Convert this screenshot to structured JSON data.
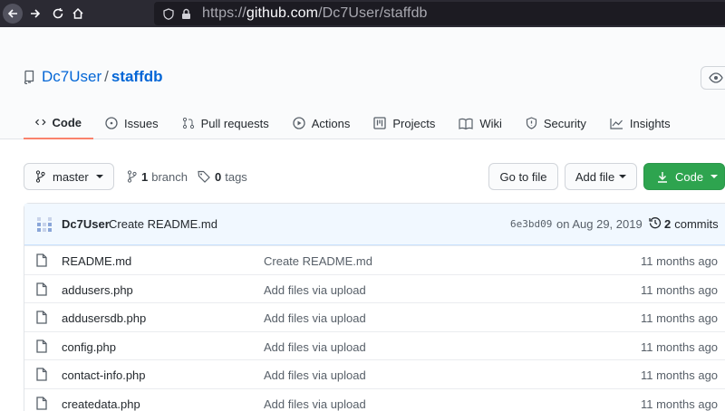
{
  "browser": {
    "url_prefix": "https://",
    "url_domain": "github.com",
    "url_path": "/Dc7User/staffdb"
  },
  "repo": {
    "owner": "Dc7User",
    "separator": "/",
    "name": "staffdb"
  },
  "tabs": [
    {
      "label": "Code",
      "icon": "code-icon"
    },
    {
      "label": "Issues",
      "icon": "issue-icon"
    },
    {
      "label": "Pull requests",
      "icon": "pull-request-icon"
    },
    {
      "label": "Actions",
      "icon": "play-icon"
    },
    {
      "label": "Projects",
      "icon": "project-icon"
    },
    {
      "label": "Wiki",
      "icon": "book-icon"
    },
    {
      "label": "Security",
      "icon": "shield-icon"
    },
    {
      "label": "Insights",
      "icon": "graph-icon"
    }
  ],
  "toolbar": {
    "branch": "master",
    "branches_count": "1",
    "branches_label": "branch",
    "tags_count": "0",
    "tags_label": "tags",
    "goto_file": "Go to file",
    "add_file": "Add file",
    "code": "Code"
  },
  "latest_commit": {
    "author": "Dc7User",
    "message": "Create README.md",
    "sha": "6e3bd09",
    "date": "on Aug 29, 2019",
    "commits_count": "2",
    "commits_label": "commits"
  },
  "files": [
    {
      "name": "README.md",
      "commit": "Create README.md",
      "age": "11 months ago"
    },
    {
      "name": "addusers.php",
      "commit": "Add files via upload",
      "age": "11 months ago"
    },
    {
      "name": "addusersdb.php",
      "commit": "Add files via upload",
      "age": "11 months ago"
    },
    {
      "name": "config.php",
      "commit": "Add files via upload",
      "age": "11 months ago"
    },
    {
      "name": "contact-info.php",
      "commit": "Add files via upload",
      "age": "11 months ago"
    },
    {
      "name": "createdata.php",
      "commit": "Add files via upload",
      "age": "11 months ago"
    }
  ],
  "colors": {
    "link": "#0366d6",
    "active_tab": "#f9826c",
    "code_button": "#2ea44f",
    "commit_bg": "#f1f8ff"
  }
}
